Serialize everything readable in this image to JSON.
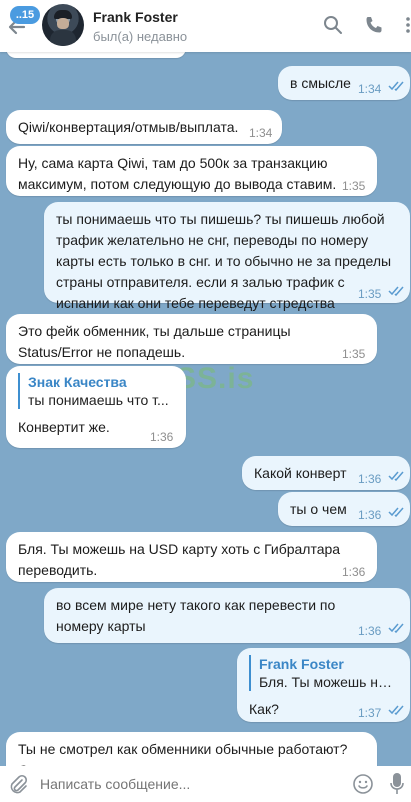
{
  "header": {
    "unread_badge": "..15",
    "contact_name": "Frank Foster",
    "contact_status": "был(а) недавно"
  },
  "watermark": "XSS.is",
  "messages": [
    {
      "dir": "out",
      "text": "в смысле",
      "time": "1:34"
    },
    {
      "dir": "in",
      "text": "Qiwi/конвертация/отмыв/выплата.",
      "time": "1:34"
    },
    {
      "dir": "in",
      "text": "Ну, сама карта Qiwi, там до 500к за транзакцию максимум, потом следующую до вывода ставим.",
      "time": "1:35"
    },
    {
      "dir": "out",
      "text": "ты понимаешь что ты пишешь? ты пишешь любой трафик желательно не снг, переводы по номеру карты есть только в снг. и то обычно не за пределы страны отправителя. если я залью трафик с испании как они тебе переведут стредства",
      "time": "1:35"
    },
    {
      "dir": "in",
      "text": "Это фейк обменник, ты дальше страницы Status/Error не попадешь.",
      "time": "1:35"
    },
    {
      "dir": "in",
      "reply_name": "Знак Качества",
      "reply_text": "ты понимаешь что т...",
      "text": "Конвертит же.",
      "time": "1:36"
    },
    {
      "dir": "out",
      "text": "Какой конверт",
      "time": "1:36"
    },
    {
      "dir": "out",
      "text": "ты о чем",
      "time": "1:36"
    },
    {
      "dir": "in",
      "text": "Бля. Ты можешь на USD карту хоть с Гибралтара переводить.",
      "time": "1:36"
    },
    {
      "dir": "out",
      "text": "во всем мире нету такого как перевести по номеру карты",
      "time": "1:36"
    },
    {
      "dir": "out",
      "reply_name": "Frank Foster",
      "reply_text": "Бля. Ты можешь на U...",
      "text": "Как?",
      "time": "1:37"
    },
    {
      "dir": "in",
      "text": "Ты не смотрел как обменники обычные работают? Они выдают каждому пользователю отдельную карту",
      "time": ""
    }
  ],
  "composer": {
    "placeholder": "Написать сообщение..."
  },
  "colors": {
    "chat_background": "#7fa8c8",
    "outgoing_bubble": "#eaf5fd",
    "incoming_bubble": "#ffffff",
    "accent": "#4a9be0"
  },
  "icons": [
    "back-arrow-icon",
    "search-icon",
    "phone-icon",
    "more-icon",
    "attach-icon",
    "emoji-icon",
    "mic-icon",
    "double-check-icon"
  ]
}
